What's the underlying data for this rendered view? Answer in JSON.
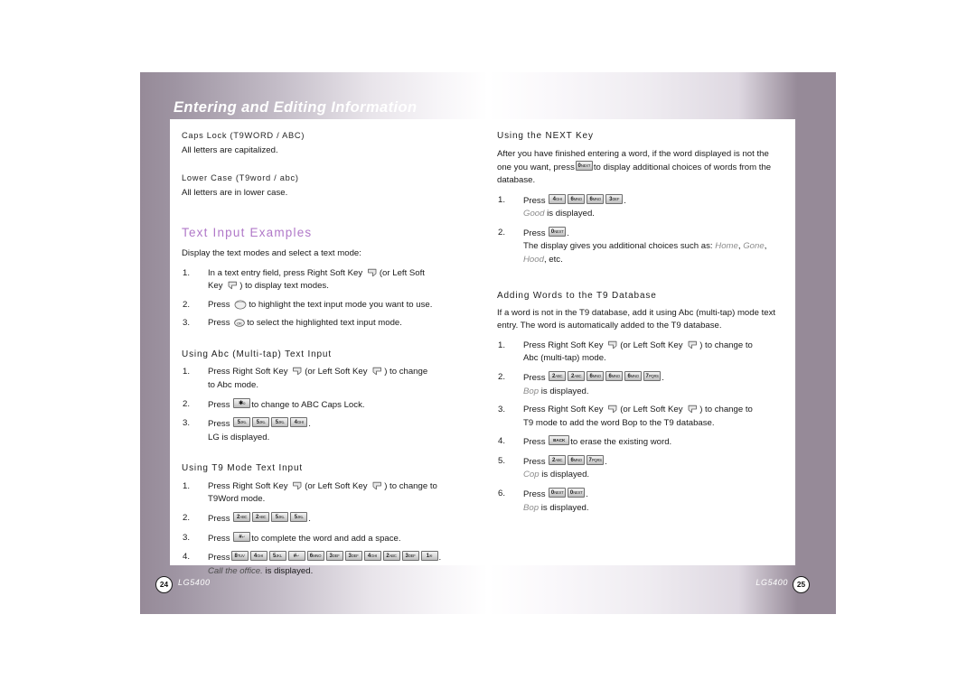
{
  "document": {
    "banner_title": "Entering and Editing Information",
    "model_name": "LG5400",
    "left_page_number": "24",
    "right_page_number": "25",
    "accent_color": "#b078c8",
    "band_color": "#968a98"
  },
  "left_page": {
    "caps_lock": {
      "heading": "Caps Lock (T9WORD / ABC)",
      "text": "All letters are capitalized."
    },
    "lower_case": {
      "heading": "Lower Case (T9word / abc)",
      "text": "All letters are in lower case."
    },
    "text_input_examples": {
      "heading": "Text Input Examples",
      "intro": "Display the text modes and select a text mode:",
      "steps": [
        {
          "num": "1.",
          "pre": "In a text entry field, press Right Soft Key",
          "icon1": "right-soft-key-icon",
          "mid": "(or Left Soft",
          "line2_pre": "Key",
          "icon2": "left-soft-key-icon",
          "line2_post": ") to display text modes."
        },
        {
          "num": "2.",
          "pre": "Press",
          "icon1": "navigation-key-icon",
          "post": "to highlight the text input mode you want to use."
        },
        {
          "num": "3.",
          "pre": "Press",
          "icon1": "ok-key-icon",
          "post": "to select the highlighted text input mode."
        }
      ]
    },
    "abc_multitap": {
      "heading": "Using Abc (Multi-tap) Text Input",
      "steps": [
        {
          "num": "1.",
          "pre": "Press Right Soft Key",
          "mid": "(or Left Soft Key",
          "post": ") to change",
          "line2": "to Abc mode."
        },
        {
          "num": "2.",
          "pre": "Press",
          "keys": [
            {
              "digit": "✱",
              "letters": "o"
            }
          ],
          "post": "to change to ABC Caps Lock."
        },
        {
          "num": "3.",
          "pre": "Press",
          "keys": [
            {
              "digit": "5",
              "letters": "JKL"
            },
            {
              "digit": "5",
              "letters": "JKL"
            },
            {
              "digit": "5",
              "letters": "JKL"
            },
            {
              "digit": "4",
              "letters": "GHI"
            }
          ],
          "post": ".",
          "result": "LG is displayed."
        }
      ]
    },
    "t9_mode": {
      "heading": "Using T9 Mode Text Input",
      "steps": [
        {
          "num": "1.",
          "pre": "Press Right Soft Key",
          "mid": "(or Left Soft Key",
          "post": ") to change to",
          "line2": "T9Word mode."
        },
        {
          "num": "2.",
          "pre": "Press",
          "keys": [
            {
              "digit": "2",
              "letters": "ABC"
            },
            {
              "digit": "2",
              "letters": "ABC"
            },
            {
              "digit": "5",
              "letters": "JKL"
            },
            {
              "digit": "5",
              "letters": "JKL"
            }
          ],
          "post": "."
        },
        {
          "num": "3.",
          "pre": "Press",
          "keys": [
            {
              "digit": "#",
              "letters": "↵"
            }
          ],
          "post": "to complete the word and add a space."
        },
        {
          "num": "4.",
          "pre": "Press",
          "keys": [
            {
              "digit": "8",
              "letters": "TUV"
            },
            {
              "digit": "4",
              "letters": "GHI"
            },
            {
              "digit": "5",
              "letters": "JKL"
            },
            {
              "digit": "#",
              "letters": "↵"
            },
            {
              "digit": "6",
              "letters": "MNO"
            },
            {
              "digit": "3",
              "letters": "DEF"
            },
            {
              "digit": "3",
              "letters": "DEF"
            },
            {
              "digit": "4",
              "letters": "GHI"
            },
            {
              "digit": "2",
              "letters": "ABC"
            },
            {
              "digit": "3",
              "letters": "DEF"
            },
            {
              "digit": "1",
              "letters": "✉"
            }
          ],
          "post": ".",
          "result_italic": "Call the office.",
          "result_rest": "is displayed."
        }
      ]
    }
  },
  "right_page": {
    "next_key": {
      "heading": "Using the NEXT Key",
      "para_1": "After you have finished entering a word, if the word displayed",
      "para_2a": "is not the one you want, press",
      "para_key": {
        "digit": "0",
        "letters": "NEXT"
      },
      "para_2b": "to display additional choices",
      "para_3": "of words from the database.",
      "steps": [
        {
          "num": "1.",
          "pre": "Press",
          "keys": [
            {
              "digit": "4",
              "letters": "GHI"
            },
            {
              "digit": "6",
              "letters": "MNO"
            },
            {
              "digit": "6",
              "letters": "MNO"
            },
            {
              "digit": "3",
              "letters": "DEF"
            }
          ],
          "post": ".",
          "result_italic": "Good",
          "result_rest": "is displayed."
        },
        {
          "num": "2.",
          "pre": "Press",
          "keys": [
            {
              "digit": "0",
              "letters": "NEXT"
            }
          ],
          "post": ".",
          "line2a": "The display gives you additional choices such as:",
          "word1": "Home",
          "word2": "Gone",
          "word3": "Hood",
          "line2b": ", etc."
        }
      ]
    },
    "adding_words": {
      "heading": "Adding Words to the T9 Database",
      "para_1": "If a word is not in the T9 database, add it using Abc (multi-tap)",
      "para_2": "mode text entry. The word is automatically added to the T9",
      "para_3": "database.",
      "steps": [
        {
          "num": "1.",
          "pre": "Press Right Soft Key",
          "mid": "(or Left Soft Key",
          "post": ") to change to",
          "line2": "Abc (multi-tap) mode."
        },
        {
          "num": "2.",
          "pre": "Press",
          "keys": [
            {
              "digit": "2",
              "letters": "ABC"
            },
            {
              "digit": "2",
              "letters": "ABC"
            },
            {
              "digit": "6",
              "letters": "MNO"
            },
            {
              "digit": "6",
              "letters": "MNO"
            },
            {
              "digit": "6",
              "letters": "MNO"
            },
            {
              "digit": "7",
              "letters": "PQRS"
            }
          ],
          "post": ".",
          "result_italic": "Bop",
          "result_rest": "is displayed."
        },
        {
          "num": "3.",
          "pre": "Press Right Soft Key",
          "mid": "(or Left Soft Key",
          "post": ") to change to",
          "line2": "T9 mode to add the word Bop to the T9 database."
        },
        {
          "num": "4.",
          "pre": "Press",
          "keys": [
            {
              "digit": "BACK",
              "letters": ""
            }
          ],
          "post": "to erase the existing word."
        },
        {
          "num": "5.",
          "pre": "Press",
          "keys": [
            {
              "digit": "2",
              "letters": "ABC"
            },
            {
              "digit": "6",
              "letters": "MNO"
            },
            {
              "digit": "7",
              "letters": "PQRS"
            }
          ],
          "post": ".",
          "result_italic": "Cop",
          "result_rest": "is displayed."
        },
        {
          "num": "6.",
          "pre": "Press",
          "keys": [
            {
              "digit": "0",
              "letters": "NEXT"
            },
            {
              "digit": "0",
              "letters": "NEXT"
            }
          ],
          "post": ".",
          "result_italic": "Bop",
          "result_rest": "is displayed."
        }
      ]
    }
  }
}
